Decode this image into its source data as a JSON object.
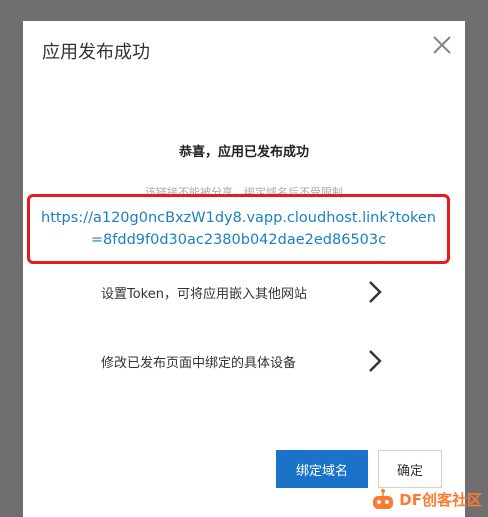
{
  "dialog": {
    "title": "应用发布成功",
    "close_icon": "close-icon",
    "success_message": "恭喜，应用已发布成功",
    "note": "该链接不能被分享，绑定域名后不受限制",
    "link_url": "https://a120g0ncBxzW1dy8.vapp.cloudhost.link?token=8fdd9f0d30ac2380b042dae2ed86503c",
    "highlight_color": "#e41c1c",
    "options": [
      {
        "label": "设置Token，可将应用嵌入其他网站",
        "icon": "chevron-right-icon"
      },
      {
        "label": "修改已发布页面中绑定的具体设备",
        "icon": "chevron-right-icon"
      }
    ],
    "buttons": {
      "primary_label": "绑定域名",
      "primary_color": "#1a73c8",
      "secondary_label": "确定"
    }
  },
  "watermark": {
    "text": "DF创客社区",
    "color": "#ff7a2e"
  }
}
